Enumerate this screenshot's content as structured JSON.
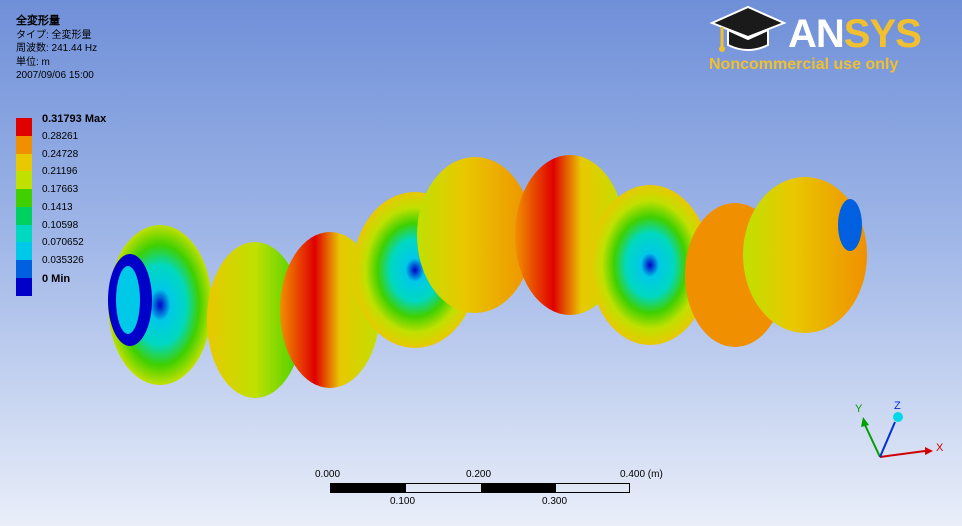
{
  "info": {
    "title": "全変形量",
    "type_line": "タイプ: 全変形量",
    "freq_line": "周波数: 241.44 Hz",
    "unit_line": "単位: m",
    "date_line": "2007/09/06 15:00"
  },
  "legend": [
    {
      "label": "0.31793 Max",
      "color": "#e00000",
      "bold": true
    },
    {
      "label": "0.28261",
      "color": "#f09000",
      "bold": false
    },
    {
      "label": "0.24728",
      "color": "#e8c800",
      "bold": false
    },
    {
      "label": "0.21196",
      "color": "#c0e000",
      "bold": false
    },
    {
      "label": "0.17663",
      "color": "#40d000",
      "bold": false
    },
    {
      "label": "0.1413",
      "color": "#00d060",
      "bold": false
    },
    {
      "label": "0.10598",
      "color": "#00d8c0",
      "bold": false
    },
    {
      "label": "0.070652",
      "color": "#00c8e8",
      "bold": false
    },
    {
      "label": "0.035326",
      "color": "#0060e0",
      "bold": false
    },
    {
      "label": "0 Min",
      "color": "#0000c8",
      "bold": true
    }
  ],
  "logo": {
    "brand_prefix": "AN",
    "brand_suffix": "SYS",
    "notice": "Noncommercial use only"
  },
  "scale_bar": {
    "top_labels": [
      "0.000",
      "0.200",
      "0.400 (m)"
    ],
    "bottom_labels": [
      "0.100",
      "0.300"
    ]
  },
  "triad": {
    "x": "X",
    "y": "Y",
    "z": "Z"
  },
  "colors": {
    "red": "#e00000",
    "orange": "#f09000",
    "yellow": "#e8c800",
    "lime": "#c0e000",
    "green": "#40d000",
    "cyan": "#00d8c0",
    "blue": "#0000c8"
  }
}
